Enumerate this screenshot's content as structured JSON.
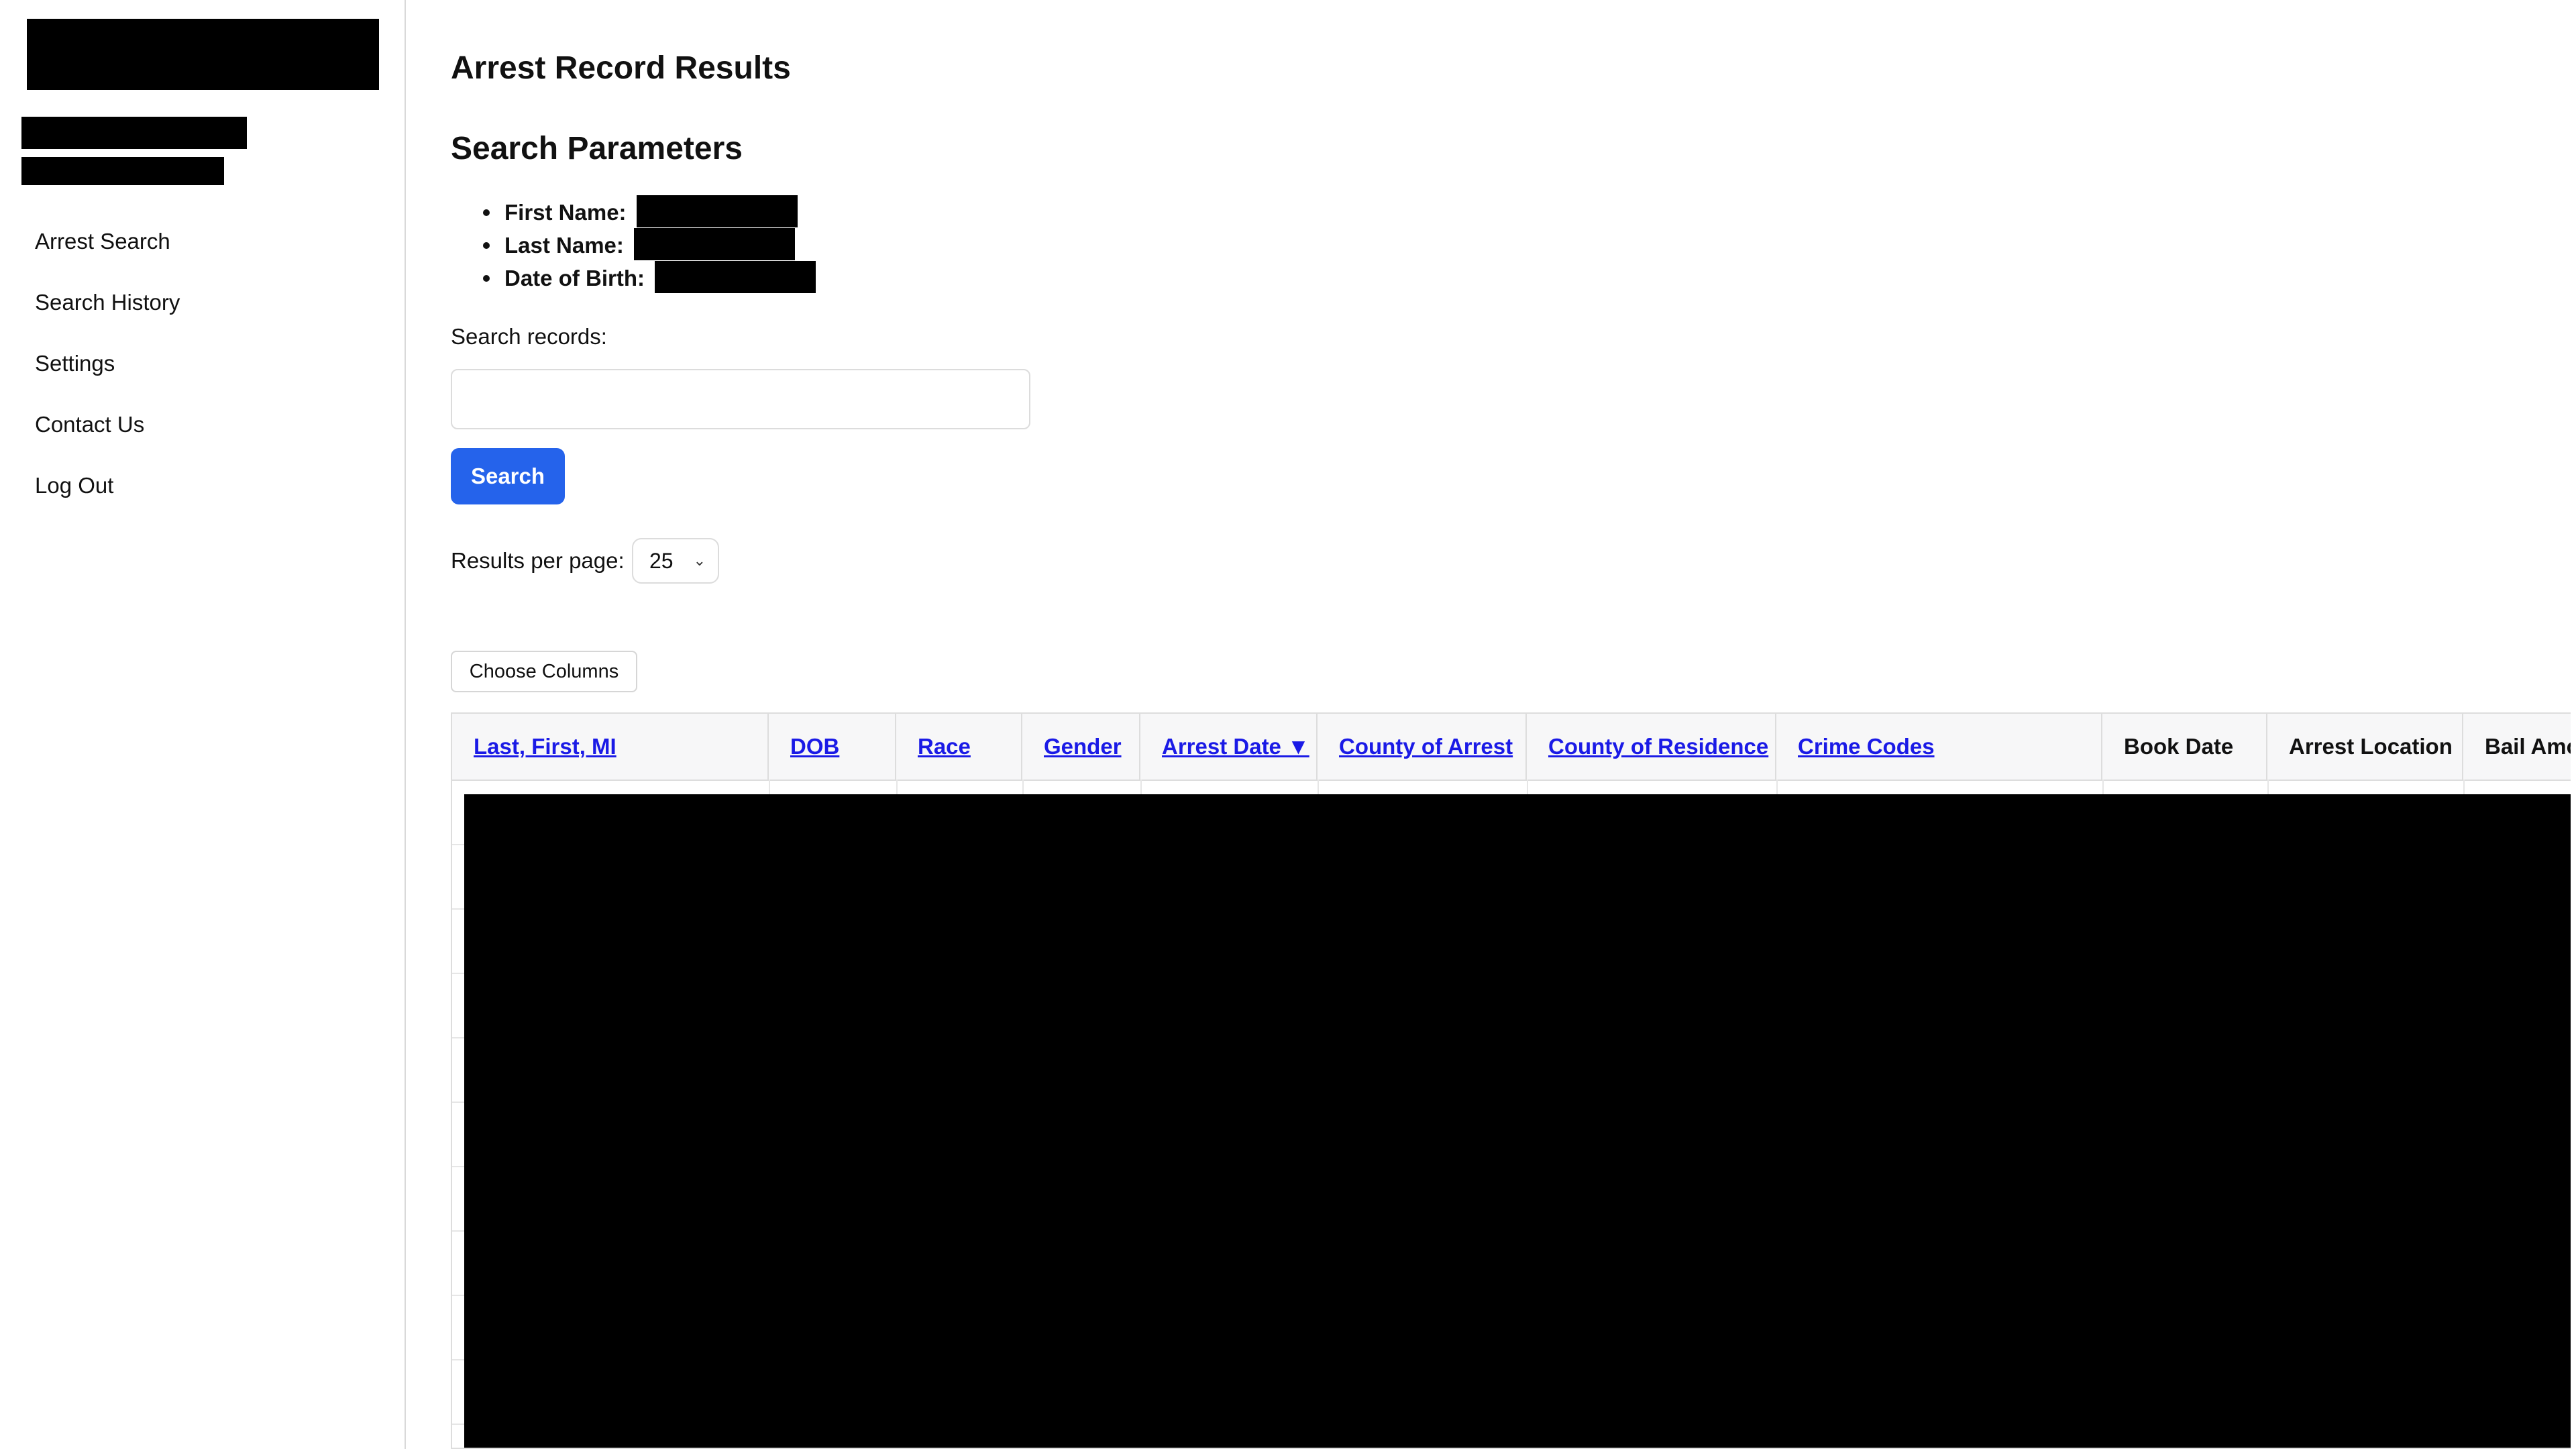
{
  "sidebar": {
    "nav": [
      {
        "label": "Arrest Search"
      },
      {
        "label": "Search History"
      },
      {
        "label": "Settings"
      },
      {
        "label": "Contact Us"
      },
      {
        "label": "Log Out"
      }
    ]
  },
  "main": {
    "title": "Arrest Record Results",
    "section_title": "Search Parameters",
    "params": [
      {
        "label": "First Name:"
      },
      {
        "label": "Last Name:"
      },
      {
        "label": "Date of Birth:"
      }
    ],
    "search_label": "Search records:",
    "search_value": "",
    "search_button": "Search",
    "rpp_label": "Results per page:",
    "rpp_value": "25",
    "choose_columns": "Choose Columns"
  },
  "table": {
    "sorted_column": "Arrest Date",
    "sort_direction": "descending",
    "columns": [
      {
        "label": "Last, First, MI",
        "sortable": true
      },
      {
        "label": "DOB",
        "sortable": true
      },
      {
        "label": "Race",
        "sortable": true
      },
      {
        "label": "Gender",
        "sortable": true
      },
      {
        "label": "Arrest Date ▼",
        "sortable": true
      },
      {
        "label": "County of Arrest",
        "sortable": true
      },
      {
        "label": "County of Residence",
        "sortable": true
      },
      {
        "label": "Crime Codes",
        "sortable": true
      },
      {
        "label": "Book Date",
        "sortable": false
      },
      {
        "label": "Arrest Location",
        "sortable": false
      },
      {
        "label": "Bail Amo",
        "sortable": false
      }
    ]
  },
  "colors": {
    "primary_button": "#2563eb",
    "link": "#1a1ae6",
    "redaction": "#000000"
  }
}
